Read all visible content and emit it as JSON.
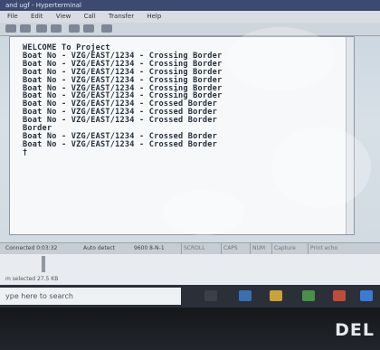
{
  "window": {
    "title": "and ugf - Hyperterminal",
    "menu": [
      "File",
      "Edit",
      "View",
      "Call",
      "Transfer",
      "Help"
    ]
  },
  "terminal": {
    "lines": [
      "WELCOME To Project",
      "Boat No - VZG/EAST/1234 - Crossing Border",
      "Boat No - VZG/EAST/1234 - Crossing Border",
      "Boat No - VZG/EAST/1234 - Crossing Border",
      "Boat No - VZG/EAST/1234 - Crossing Border",
      "Boat No - VZG/EAST/1234 - Crossing Border",
      "Boat No - VZG/EAST/1234 - Crossing Border",
      "Boat No - VZG/EAST/1234 - Crossed Border",
      "Boat No - VZG/EAST/1234 - Crossed Border",
      "Boat No - VZG/EAST/1234 - Crossed Border",
      "Border",
      "Boat No - VZG/EAST/1234 - Crossed Border",
      "Boat No - VZG/EAST/1234 - Crossed Border",
      "†"
    ]
  },
  "status": {
    "connection": "Connected 0:03:32",
    "detect": "Auto detect",
    "settings": "9600 8-N-1",
    "scroll": "SCROLL",
    "caps": "CAPS",
    "num": "NUM",
    "capture": "Capture",
    "print": "Print echo"
  },
  "explorer": {
    "selection": "m selected  27.5 KB"
  },
  "taskbar": {
    "search_placeholder": "ype here to search"
  },
  "bezel": {
    "logo": "DEL"
  }
}
